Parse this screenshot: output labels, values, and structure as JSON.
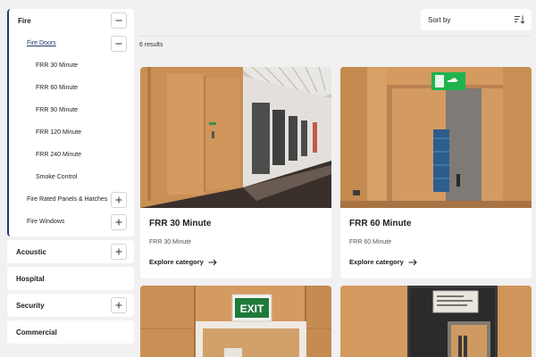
{
  "sidebar": {
    "fire": {
      "label": "Fire",
      "fire_doors": {
        "label": "Fire Doors",
        "items": [
          "FRR 30 Minute",
          "FRR 60 Minute",
          "FRR 90 Minute",
          "FRR 120 Minute",
          "FRR 240 Minute",
          "Smoke Control"
        ]
      },
      "panels_label": "Fire Rated Panels & Hatches",
      "windows_label": "Fire Windows"
    },
    "acoustic_label": "Acoustic",
    "hospital_label": "Hospital",
    "security_label": "Security",
    "commercial_label": "Commercial"
  },
  "sort": {
    "label": "Sort by",
    "icon": "sort-icon"
  },
  "results": {
    "text": "6 results"
  },
  "cards": [
    {
      "title": "FRR 30 Minute",
      "subtitle": "FRR 30 Minute",
      "link": "Explore category"
    },
    {
      "title": "FRR 60 Minute",
      "subtitle": "FRR 60 Minute",
      "link": "Explore category"
    }
  ],
  "card_images": {
    "exit_sign": "EXIT"
  },
  "colors": {
    "accent": "#1f3a6e",
    "background": "#f1f1f1",
    "card": "#ffffff",
    "wood": "#c98f55"
  }
}
